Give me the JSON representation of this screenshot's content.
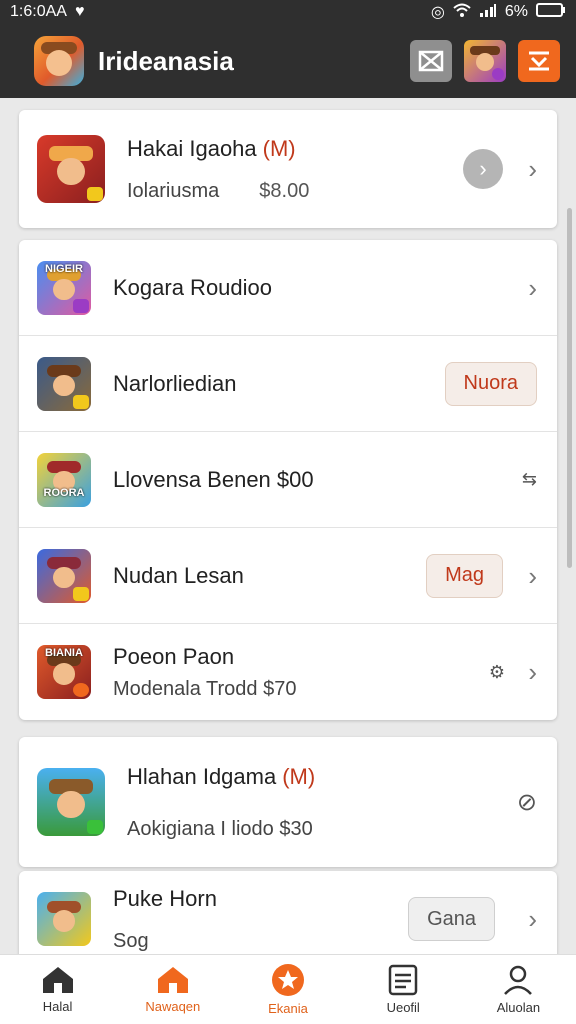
{
  "status": {
    "time": "1:6:0AA",
    "battery": "6%"
  },
  "appbar": {
    "title": "Irideanasia"
  },
  "cards": [
    {
      "rows": [
        {
          "title": "Hakai Igaoha",
          "tag": "(M)",
          "subtitle": "Iolariusma",
          "price": "$8.00"
        }
      ]
    },
    {
      "rows": [
        {
          "title": "Kogara Roudioo"
        },
        {
          "title": "Narlorliedian",
          "button": "Nuora"
        },
        {
          "title": "Llovensa Benen $00"
        },
        {
          "title": "Nudan Lesan",
          "button": "Mag"
        },
        {
          "title": "Poeon Paon",
          "subtitle": "Modenala Trodd $70"
        }
      ]
    },
    {
      "rows": [
        {
          "title": "Hlahan Idgama",
          "tag": "(M)",
          "subtitle": "Aokigiana I liodo $30"
        }
      ]
    },
    {
      "rows": [
        {
          "title": "Puke Horn",
          "subtitle": "Sog",
          "button": "Gana"
        }
      ]
    }
  ],
  "thumbs": {
    "t1": {
      "text": ""
    },
    "t2": {
      "text": "NIGEIR"
    },
    "t3": {
      "text": ""
    },
    "t4": {
      "text": "ROORA"
    },
    "t5": {
      "text": ""
    },
    "t6": {
      "text": "BIANIA"
    },
    "t7": {
      "text": ""
    },
    "t8": {
      "text": ""
    }
  },
  "nav": [
    {
      "label": "Halal",
      "icon": "home-icon"
    },
    {
      "label": "Nawaqen",
      "icon": "home-icon"
    },
    {
      "label": "Ekania",
      "icon": "star-icon"
    },
    {
      "label": "Ueofil",
      "icon": "document-icon"
    },
    {
      "label": "Aluolan",
      "icon": "person-icon"
    }
  ],
  "colors": {
    "accent": "#f0681e",
    "appbar": "#2f2f2f"
  }
}
